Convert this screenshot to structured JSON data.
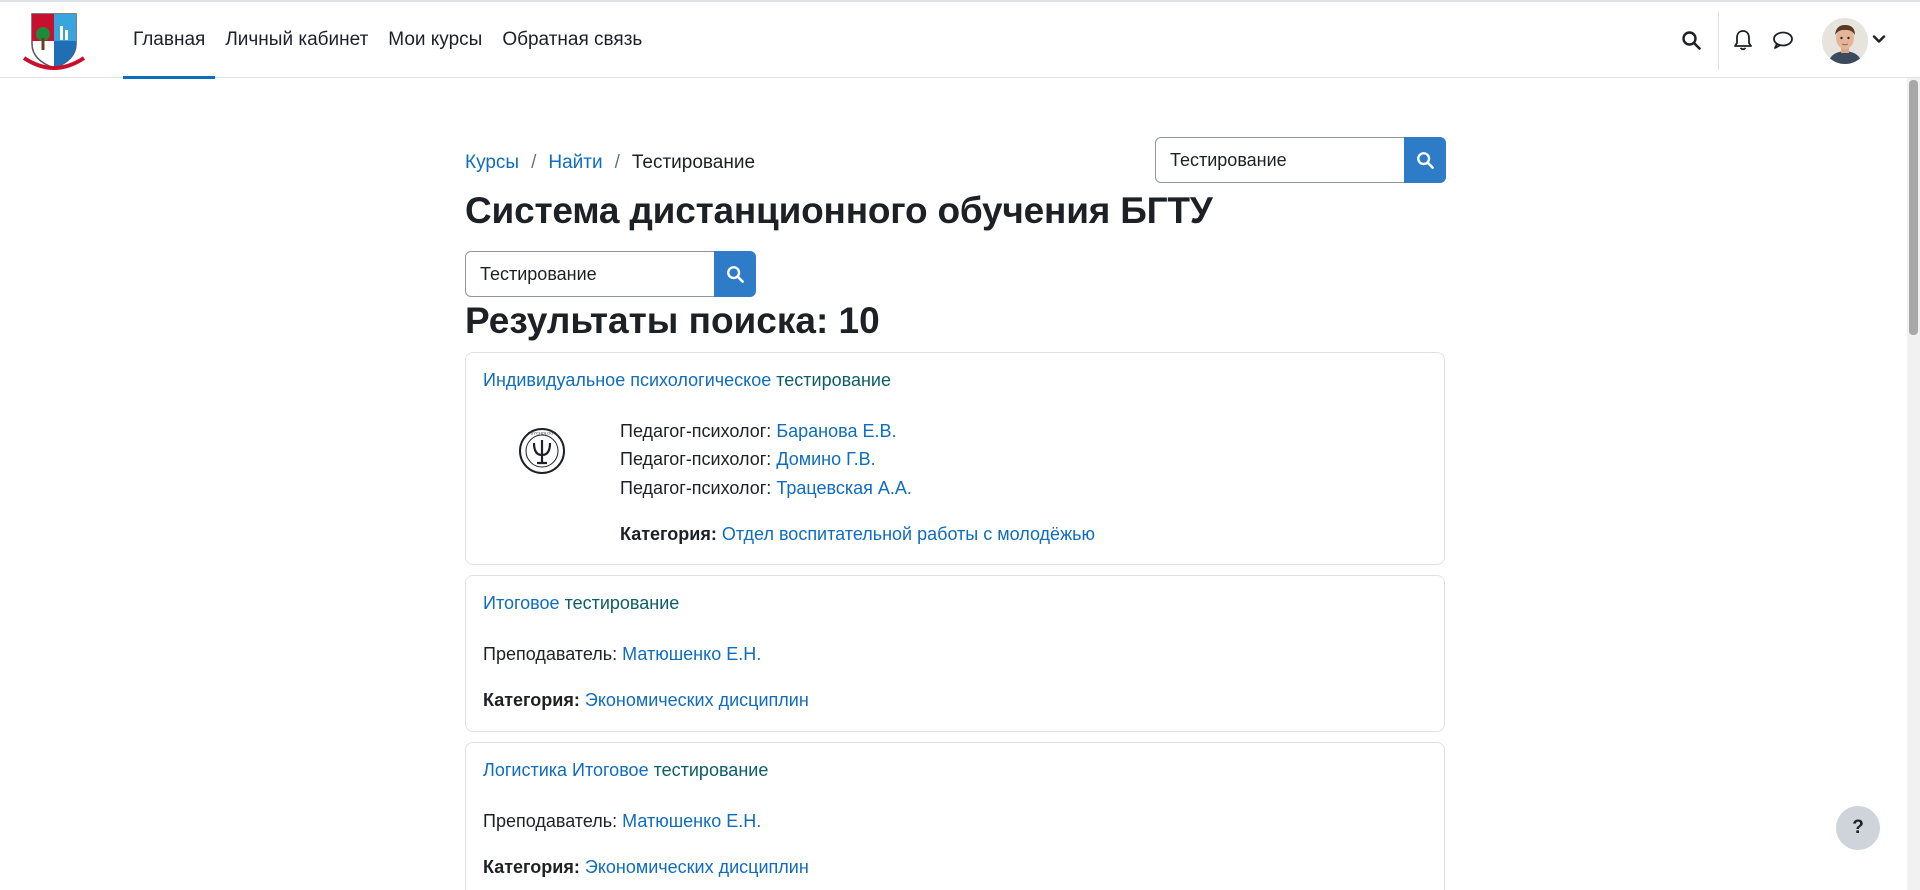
{
  "nav": {
    "items": [
      {
        "label": "Главная",
        "active": true
      },
      {
        "label": "Личный кабинет",
        "active": false
      },
      {
        "label": "Мои курсы",
        "active": false
      },
      {
        "label": "Обратная связь",
        "active": false
      }
    ],
    "accent_color": "#0f6cbf"
  },
  "breadcrumb": {
    "items": [
      "Курсы",
      "Найти"
    ],
    "current": "Тестирование",
    "separator": "/"
  },
  "header_search": {
    "value": "Тестирование"
  },
  "page_title": "Система дистанционного обучения БГТУ",
  "main_search": {
    "value": "Тестирование"
  },
  "results_heading": "Результаты поиска: 10",
  "results": [
    {
      "title_prefix": "Индивидуальное психологическое ",
      "title_highlight": "тестирование",
      "image_icon": "psi-seal-icon",
      "contacts": [
        {
          "role": "Педагог-психолог:",
          "name": "Баранова Е.В."
        },
        {
          "role": "Педагог-психолог:",
          "name": "Домино Г.В."
        },
        {
          "role": "Педагог-психолог:",
          "name": "Трацевская А.А."
        }
      ],
      "category_label": "Категория:",
      "category": "Отдел воспитательной работы с молодёжью"
    },
    {
      "title_prefix": "Итоговое ",
      "title_highlight": "тестирование",
      "contacts": [
        {
          "role": "Преподаватель:",
          "name": "Матюшенко Е.Н."
        }
      ],
      "category_label": "Категория:",
      "category": "Экономических дисциплин"
    },
    {
      "title_prefix": "Логистика Итоговое ",
      "title_highlight": "тестирование",
      "contacts": [
        {
          "role": "Преподаватель:",
          "name": "Матюшенко Е.Н."
        }
      ],
      "category_label": "Категория:",
      "category": "Экономических дисциплин"
    }
  ],
  "help_button": {
    "label": "?"
  }
}
